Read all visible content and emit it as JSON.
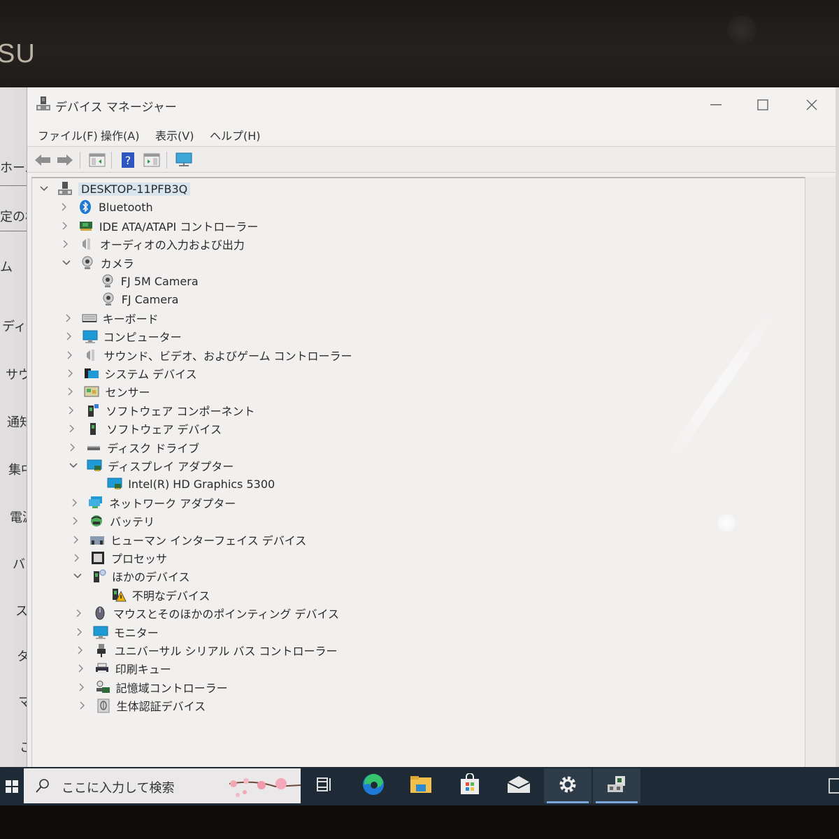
{
  "bezel": {
    "brand_partial": "SU"
  },
  "settings_sidebar": {
    "items": [
      "ホーム",
      "定の検",
      "ム",
      "ディス",
      "サウン",
      "通知&",
      "集中モ",
      "電源&",
      "バッテ",
      "ストレ",
      "タブレ",
      "マルチ",
      "この P"
    ]
  },
  "window": {
    "title": "デバイス マネージャー",
    "controls": {
      "minimize": "—",
      "maximize": "☐",
      "close": "✕"
    }
  },
  "menu": {
    "items": [
      "ファイル(F)",
      "操作(A)",
      "表示(V)",
      "ヘルプ(H)"
    ]
  },
  "toolbar": {
    "buttons": [
      "back",
      "forward",
      "show-hide-console-tree",
      "help",
      "properties",
      "scan-hardware"
    ]
  },
  "tree": {
    "root": {
      "label": "DESKTOP-11PFB3Q",
      "expanded": true,
      "icon": "computer-network-icon"
    },
    "items": [
      {
        "label": "Bluetooth",
        "level": 1,
        "expandable": true,
        "expanded": false,
        "icon": "bluetooth-icon"
      },
      {
        "label": "IDE ATA/ATAPI コントローラー",
        "level": 1,
        "expandable": true,
        "expanded": false,
        "icon": "ide-controller-icon"
      },
      {
        "label": "オーディオの入力および出力",
        "level": 1,
        "expandable": true,
        "expanded": false,
        "icon": "speaker-icon"
      },
      {
        "label": "カメラ",
        "level": 1,
        "expandable": true,
        "expanded": true,
        "icon": "camera-icon"
      },
      {
        "label": "FJ 5M Camera",
        "level": 2,
        "expandable": false,
        "icon": "camera-icon"
      },
      {
        "label": "FJ Camera",
        "level": 2,
        "expandable": false,
        "icon": "camera-icon"
      },
      {
        "label": "キーボード",
        "level": 1,
        "expandable": true,
        "expanded": false,
        "icon": "keyboard-icon"
      },
      {
        "label": "コンピューター",
        "level": 1,
        "expandable": true,
        "expanded": false,
        "icon": "monitor-icon"
      },
      {
        "label": "サウンド、ビデオ、およびゲーム コントローラー",
        "level": 1,
        "expandable": true,
        "expanded": false,
        "icon": "speaker-icon"
      },
      {
        "label": "システム デバイス",
        "level": 1,
        "expandable": true,
        "expanded": false,
        "icon": "system-folder-icon"
      },
      {
        "label": "センサー",
        "level": 1,
        "expandable": true,
        "expanded": false,
        "icon": "sensor-icon"
      },
      {
        "label": "ソフトウェア コンポーネント",
        "level": 1,
        "expandable": true,
        "expanded": false,
        "icon": "software-component-icon"
      },
      {
        "label": "ソフトウェア デバイス",
        "level": 1,
        "expandable": true,
        "expanded": false,
        "icon": "software-device-icon"
      },
      {
        "label": "ディスク ドライブ",
        "level": 1,
        "expandable": true,
        "expanded": false,
        "icon": "disk-drive-icon"
      },
      {
        "label": "ディスプレイ アダプター",
        "level": 1,
        "expandable": true,
        "expanded": true,
        "icon": "display-adapter-icon"
      },
      {
        "label": "Intel(R) HD Graphics 5300",
        "level": 2,
        "expandable": false,
        "icon": "display-adapter-icon"
      },
      {
        "label": "ネットワーク アダプター",
        "level": 1,
        "expandable": true,
        "expanded": false,
        "icon": "network-adapter-icon"
      },
      {
        "label": "バッテリ",
        "level": 1,
        "expandable": true,
        "expanded": false,
        "icon": "battery-icon"
      },
      {
        "label": "ヒューマン インターフェイス デバイス",
        "level": 1,
        "expandable": true,
        "expanded": false,
        "icon": "hid-icon"
      },
      {
        "label": "プロセッサ",
        "level": 1,
        "expandable": true,
        "expanded": false,
        "icon": "processor-icon"
      },
      {
        "label": "ほかのデバイス",
        "level": 1,
        "expandable": true,
        "expanded": true,
        "icon": "unknown-device-icon"
      },
      {
        "label": "不明なデバイス",
        "level": 2,
        "expandable": false,
        "icon": "warning-device-icon"
      },
      {
        "label": "マウスとそのほかのポインティング デバイス",
        "level": 1,
        "expandable": true,
        "expanded": false,
        "icon": "mouse-icon"
      },
      {
        "label": "モニター",
        "level": 1,
        "expandable": true,
        "expanded": false,
        "icon": "monitor-icon"
      },
      {
        "label": "ユニバーサル シリアル バス コントローラー",
        "level": 1,
        "expandable": true,
        "expanded": false,
        "icon": "usb-icon"
      },
      {
        "label": "印刷キュー",
        "level": 1,
        "expandable": true,
        "expanded": false,
        "icon": "printer-icon"
      },
      {
        "label": "記憶域コントローラー",
        "level": 1,
        "expandable": true,
        "expanded": false,
        "icon": "storage-controller-icon"
      },
      {
        "label": "生体認証デバイス",
        "level": 1,
        "expandable": true,
        "expanded": false,
        "icon": "fingerprint-icon"
      }
    ]
  },
  "taskbar": {
    "search_placeholder": "ここに入力して検索",
    "apps": [
      {
        "name": "task-view",
        "active": false,
        "running": false
      },
      {
        "name": "edge",
        "active": false,
        "running": false
      },
      {
        "name": "file-explorer",
        "active": false,
        "running": false
      },
      {
        "name": "store",
        "active": false,
        "running": false
      },
      {
        "name": "mail",
        "active": false,
        "running": false
      },
      {
        "name": "settings",
        "active": false,
        "running": true
      },
      {
        "name": "device-manager",
        "active": true,
        "running": true
      }
    ]
  },
  "colors": {
    "taskbar": "#1e2a36",
    "running_indicator": "#7aa7d9",
    "selection": "#d8e4ee",
    "window_bg": "#f1efee"
  }
}
